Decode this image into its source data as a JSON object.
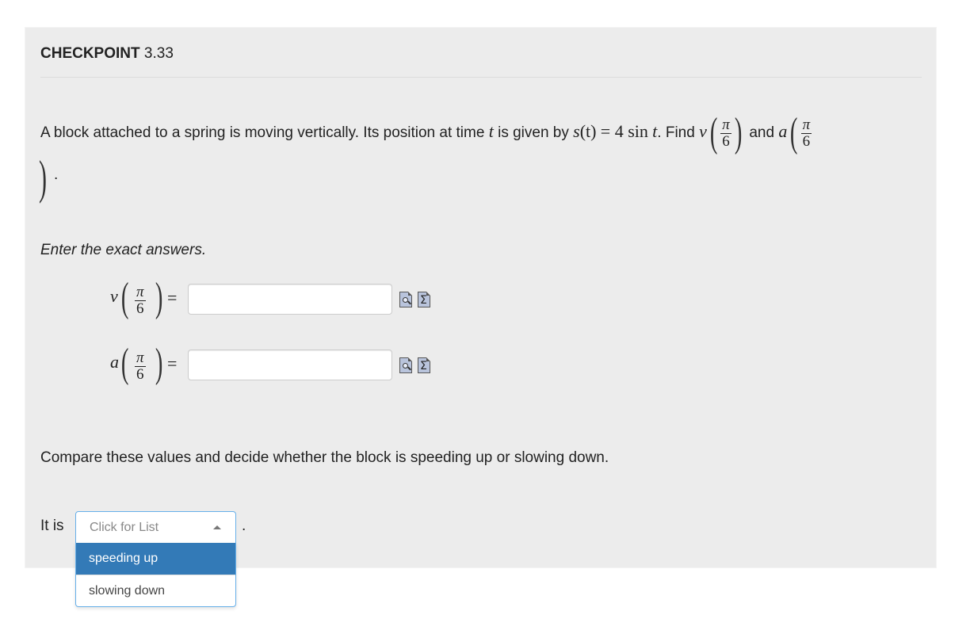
{
  "checkpoint": {
    "label": "CHECKPOINT",
    "number": "3.33"
  },
  "problem": {
    "text_a": "A block attached to a spring is moving vertically. Its position at time",
    "var_t": "t",
    "text_b": "is given by",
    "expr_lhs": "s",
    "expr_arg": "(t)",
    "expr_eq": "= 4 sin",
    "expr_t": "t",
    "text_c": ". Find",
    "v": "v",
    "text_and": "and",
    "a": "a",
    "frac_num": "π",
    "frac_den": "6",
    "end_period": "."
  },
  "instruction": "Enter the exact answers.",
  "answers": [
    {
      "var": "v",
      "frac_num": "π",
      "frac_den": "6",
      "eq": "=",
      "value": ""
    },
    {
      "var": "a",
      "frac_num": "π",
      "frac_den": "6",
      "eq": "=",
      "value": ""
    }
  ],
  "compare_text": "Compare these values and decide whether the block is speeding up or slowing down.",
  "dropdown": {
    "prefix": "It is",
    "placeholder": "Click for List",
    "suffix": ".",
    "options": [
      "speeding up",
      "slowing down"
    ],
    "highlighted": "speeding up"
  }
}
